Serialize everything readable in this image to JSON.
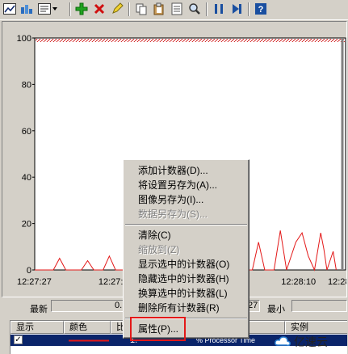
{
  "toolbar": {
    "buttons": [
      "view-graph-icon",
      "view-histogram-icon",
      "view-report-icon",
      "dropdown-icon",
      "add-counter-icon",
      "delete-counter-icon",
      "highlight-icon",
      "copy-icon",
      "paste-icon",
      "properties-icon",
      "zoom-icon",
      "freeze-icon",
      "update-icon",
      "help-icon"
    ]
  },
  "chart_data": {
    "type": "line",
    "ylim": [
      0,
      100
    ],
    "y_ticks": [
      "100",
      "80",
      "60",
      "40",
      "20",
      "0"
    ],
    "x_ticks": [
      "12:27:27",
      "12:27:",
      "12:28:10",
      "12:28:"
    ],
    "series": [
      {
        "color": "#e31818",
        "points": [
          [
            0,
            0
          ],
          [
            6,
            0
          ],
          [
            8,
            5
          ],
          [
            10,
            0
          ],
          [
            15,
            0
          ],
          [
            17,
            4
          ],
          [
            19,
            0
          ],
          [
            22,
            0
          ],
          [
            24,
            6
          ],
          [
            26,
            0
          ],
          [
            70,
            0
          ],
          [
            72,
            12
          ],
          [
            74,
            0
          ],
          [
            77,
            0
          ],
          [
            79,
            17
          ],
          [
            81,
            0
          ],
          [
            84,
            12
          ],
          [
            86,
            16
          ],
          [
            88,
            6
          ],
          [
            90,
            0
          ],
          [
            92,
            16
          ],
          [
            93,
            9
          ],
          [
            94,
            0
          ],
          [
            96,
            8
          ],
          [
            97,
            0
          ]
        ]
      }
    ],
    "grid": false,
    "hatched_top": true
  },
  "stats": {
    "latest_label": "最新",
    "latest_value": "0.",
    "average_value": "27",
    "min_label": "最小"
  },
  "listview": {
    "columns": [
      "显示",
      "颜色",
      "比",
      "",
      "实例"
    ],
    "row_text": "1.",
    "row_counter": "% Processor Time"
  },
  "context_menu": {
    "items": [
      {
        "label": "添加计数器(D)...",
        "enabled": true
      },
      {
        "label": "将设置另存为(A)...",
        "enabled": true
      },
      {
        "label": "图像另存为(I)...",
        "enabled": true
      },
      {
        "label": "数据另存为(S)...",
        "enabled": false
      },
      {
        "separator": true
      },
      {
        "label": "清除(C)",
        "enabled": true
      },
      {
        "label": "缩放到(Z)",
        "enabled": false
      },
      {
        "label": "显示选中的计数器(O)",
        "enabled": true
      },
      {
        "label": "隐藏选中的计数器(H)",
        "enabled": true
      },
      {
        "label": "换算选中的计数器(L)",
        "enabled": true
      },
      {
        "label": "删除所有计数器(R)",
        "enabled": true
      },
      {
        "separator": true
      },
      {
        "label": "属性(P)...",
        "enabled": true
      }
    ]
  },
  "watermark": {
    "text": "亿速云"
  }
}
